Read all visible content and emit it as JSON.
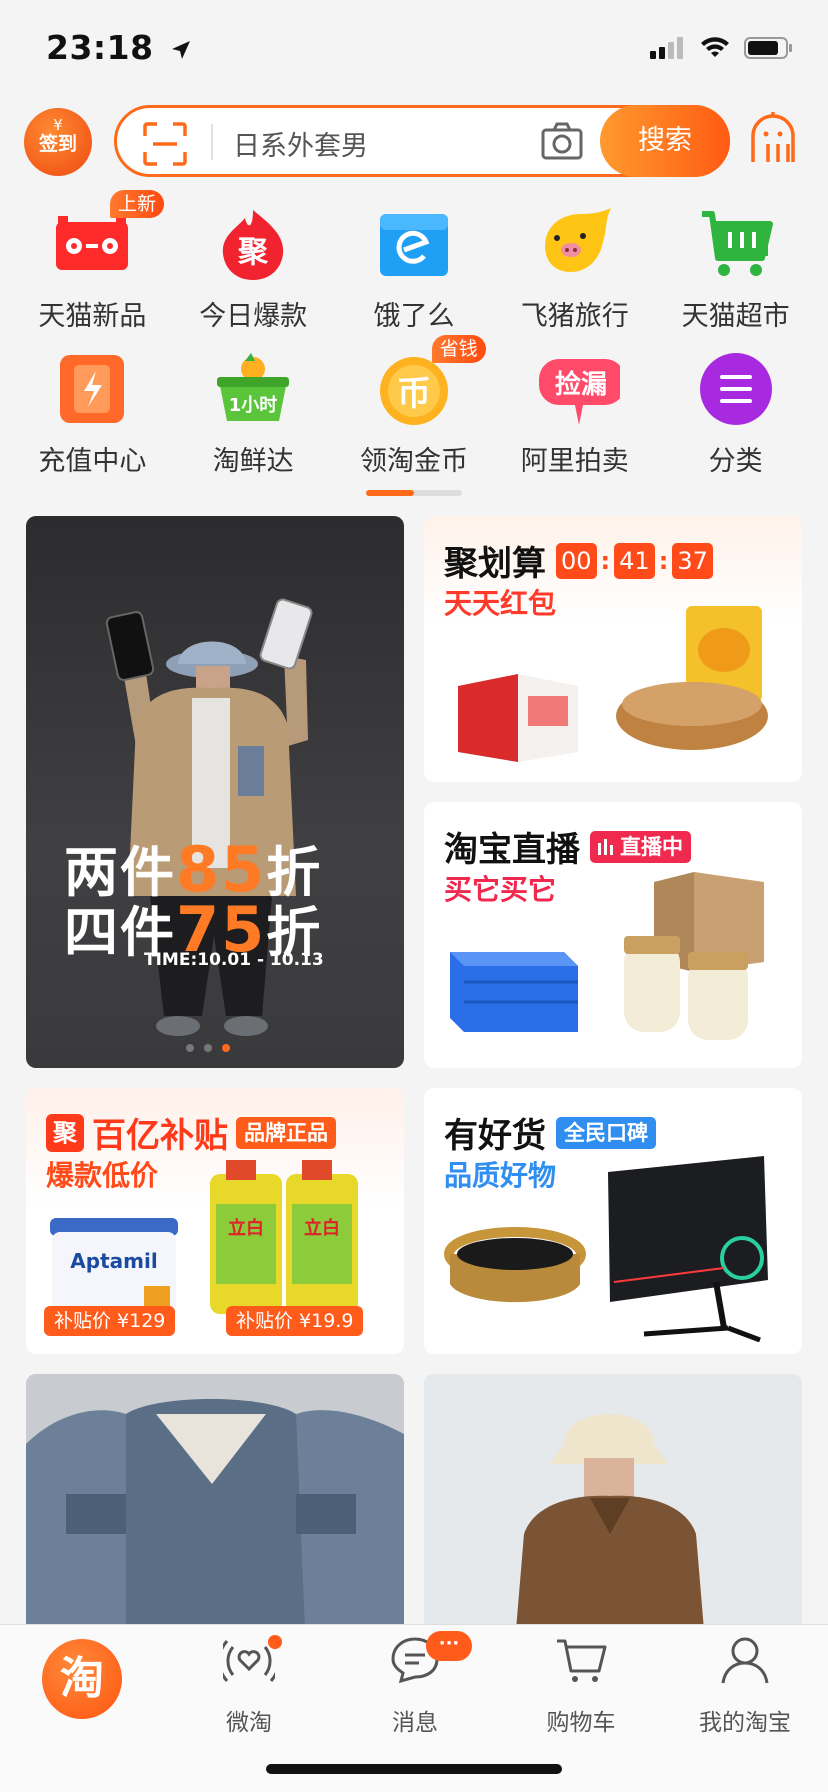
{
  "status": {
    "time": "23:18"
  },
  "header": {
    "checkin_label": "签到",
    "checkin_symbol": "¥",
    "search_placeholder": "日系外套男",
    "search_button": "搜索"
  },
  "grid": [
    {
      "label": "天猫新品",
      "icon": "tmall-new-icon",
      "badge": "上新"
    },
    {
      "label": "今日爆款",
      "icon": "ju-hot-icon",
      "glyph": "聚"
    },
    {
      "label": "饿了么",
      "icon": "eleme-icon"
    },
    {
      "label": "飞猪旅行",
      "icon": "fliggy-icon"
    },
    {
      "label": "天猫超市",
      "icon": "tmall-market-cart-icon"
    },
    {
      "label": "充值中心",
      "icon": "recharge-icon"
    },
    {
      "label": "淘鲜达",
      "icon": "taoxianda-basket-icon",
      "glyph": "1小时"
    },
    {
      "label": "领淘金币",
      "icon": "gold-coin-icon",
      "badge": "省钱",
      "glyph": "币"
    },
    {
      "label": "阿里拍卖",
      "icon": "auction-icon",
      "glyph": "捡漏"
    },
    {
      "label": "分类",
      "icon": "category-menu-icon"
    }
  ],
  "banner": {
    "line1_a": "两件",
    "line1_b": "85",
    "line1_c": "折",
    "line2_a": "四件",
    "line2_b": "75",
    "line2_c": "折",
    "time": "TIME:10.01 - 10.13"
  },
  "juhuasuan": {
    "title": "聚划算",
    "timer": [
      "00",
      "41",
      "37"
    ],
    "subtitle": "天天红包"
  },
  "live": {
    "title": "淘宝直播",
    "tag": "直播中",
    "subtitle": "买它买它"
  },
  "subsidy": {
    "ju_glyph": "聚",
    "title": "百亿补贴",
    "tag": "品牌正品",
    "subtitle": "爆款低价",
    "price1": "补贴价 ¥129",
    "price2": "补贴价 ¥19.9",
    "product1_brand": "Aptamil",
    "product2_brand": "立白"
  },
  "goodgoods": {
    "title": "有好货",
    "tag": "全民口碑",
    "subtitle": "品质好物"
  },
  "tabbar": {
    "home_glyph": "淘",
    "weitao": "微淘",
    "messages": "消息",
    "messages_badge": "···",
    "cart": "购物车",
    "mine": "我的淘宝"
  },
  "colors": {
    "brand_orange": "#ff5b13",
    "juhuasuan_red": "#ff4a1a",
    "live_red": "#f0294f",
    "blue_accent": "#2f8ef0"
  }
}
